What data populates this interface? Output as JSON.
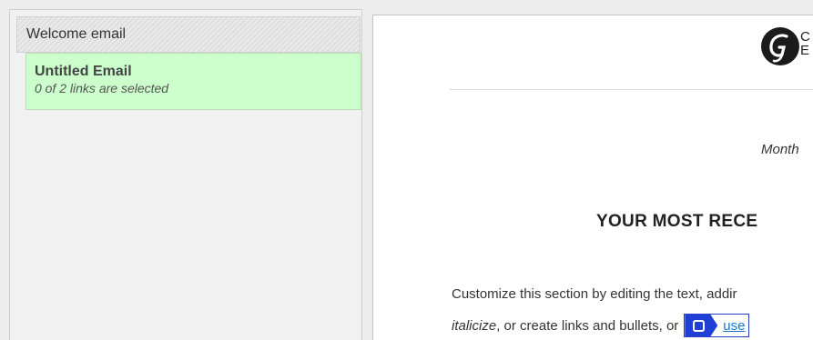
{
  "sidebar": {
    "group_title": "Welcome email",
    "items": [
      {
        "title": "Untitled Email",
        "subtitle": "0 of 2 links are selected"
      }
    ]
  },
  "preview": {
    "logo_icon": "constant-contact-g-logo-icon",
    "logo_text_line1": "C",
    "logo_text_line2": "E",
    "month_text": "Month",
    "headline": "YOUR MOST RECE",
    "body_line1": "Customize this section by editing the text, addir",
    "body_line2_italic": "italicize",
    "body_line2_text": ", or create links and bullets, or",
    "link_chip_icon": "link-selector-square-icon",
    "link_text": "use"
  },
  "colors": {
    "selected_item_bg": "#ccffcc",
    "link_badge": "#1f3fd6",
    "link_text": "#1a73c9"
  }
}
